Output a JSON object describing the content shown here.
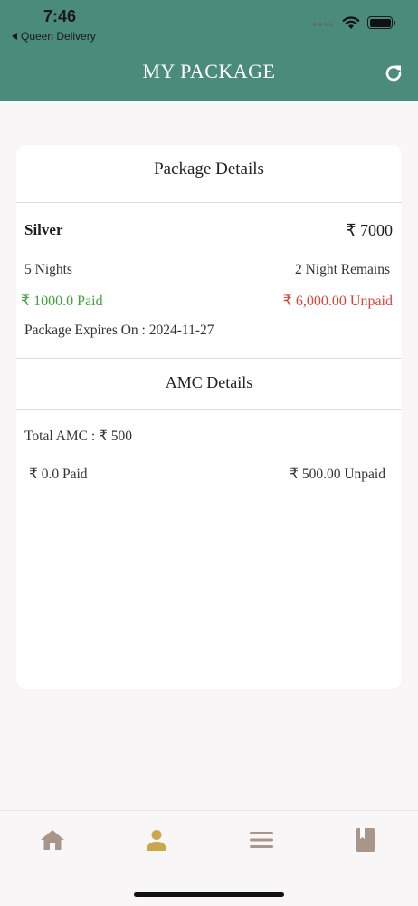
{
  "status_bar": {
    "time": "7:46",
    "back_app": "Queen Delivery"
  },
  "header": {
    "title": "MY PACKAGE",
    "refresh_icon": "refresh-icon"
  },
  "package_details": {
    "section_title": "Package Details",
    "name": "Silver",
    "price": "₹ 7000",
    "nights": "5 Nights",
    "remaining": "2 Night Remains",
    "paid": "₹ 1000.0 Paid",
    "unpaid": "₹ 6,000.00 Unpaid",
    "expires": "Package Expires On : 2024-11-27"
  },
  "amc_details": {
    "section_title": "AMC Details",
    "total": "Total AMC :  ₹ 500",
    "paid": "₹ 0.0 Paid",
    "unpaid": "₹ 500.00 Unpaid"
  },
  "bottom_nav": {
    "items": [
      {
        "name": "home",
        "icon": "home-icon",
        "active": false
      },
      {
        "name": "profile",
        "icon": "person-icon",
        "active": true
      },
      {
        "name": "menu",
        "icon": "menu-icon",
        "active": false
      },
      {
        "name": "bookings",
        "icon": "book-icon",
        "active": false
      }
    ]
  },
  "colors": {
    "header_bg": "#4a8b7b",
    "paid_green": "#3ea33a",
    "unpaid_red": "#d6463a",
    "nav_active": "#c8a84a",
    "nav_inactive": "#a8968a"
  }
}
